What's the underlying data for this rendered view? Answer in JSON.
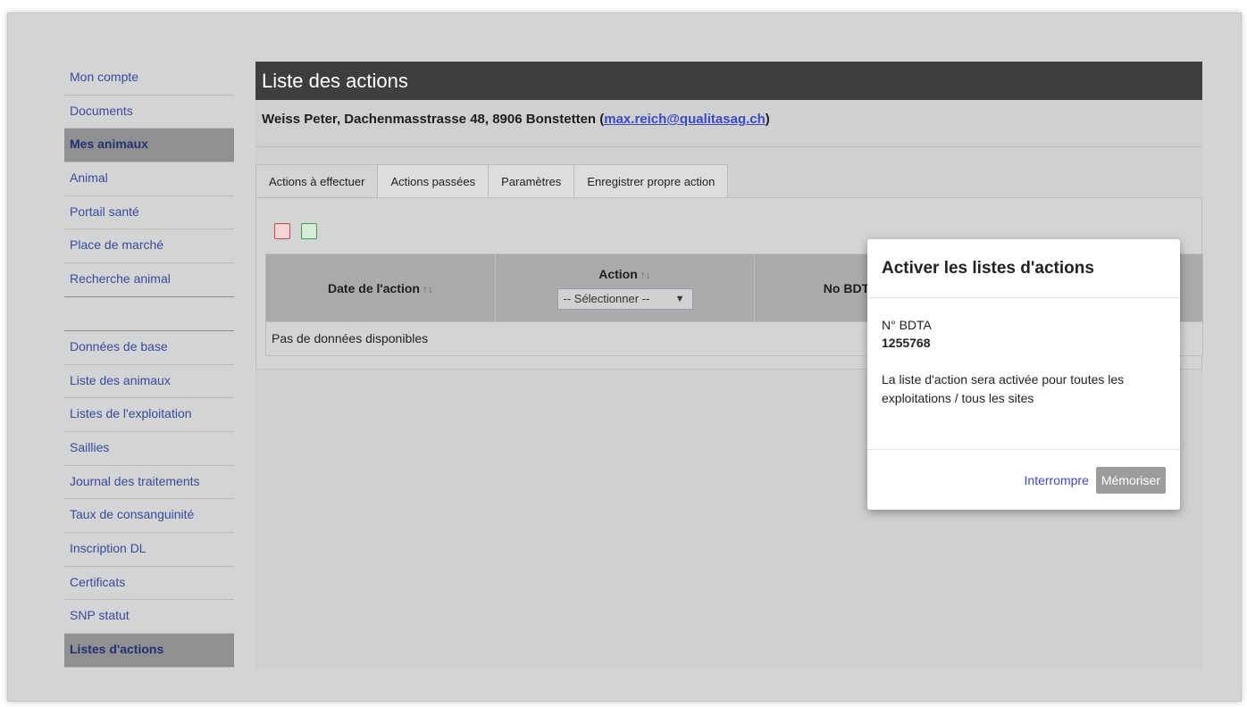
{
  "sidebar": {
    "items": [
      {
        "label": "Mon compte",
        "active": false
      },
      {
        "label": "Documents",
        "active": false
      },
      {
        "label": "Mes animaux",
        "active": true
      },
      {
        "label": "Animal",
        "active": false
      },
      {
        "label": "Portail santé",
        "active": false
      },
      {
        "label": "Place de marché",
        "active": false
      },
      {
        "label": "Recherche animal",
        "active": false
      }
    ],
    "items2": [
      {
        "label": "Données de base",
        "active": false
      },
      {
        "label": "Liste des animaux",
        "active": false
      },
      {
        "label": "Listes de l'exploitation",
        "active": false
      },
      {
        "label": "Saillies",
        "active": false
      },
      {
        "label": "Journal des traitements",
        "active": false
      },
      {
        "label": "Taux de consanguinité",
        "active": false
      },
      {
        "label": "Inscription DL",
        "active": false
      },
      {
        "label": "Certificats",
        "active": false
      },
      {
        "label": "SNP statut",
        "active": false
      },
      {
        "label": "Listes d'actions",
        "active": true
      }
    ]
  },
  "main": {
    "title": "Liste des actions",
    "owner": {
      "text": "Weiss Peter, Dachenmasstrasse 48, 8906 Bonstetten (",
      "email": "max.reich@qualitasag.ch",
      "close": ")"
    },
    "tabs": [
      {
        "label": "Actions à effectuer",
        "active": true
      },
      {
        "label": "Actions passées",
        "active": false
      },
      {
        "label": "Paramètres",
        "active": false
      },
      {
        "label": "Enregistrer propre action",
        "active": false
      }
    ],
    "toolbar": {
      "pdf_icon": "pdf-icon",
      "excel_icon": "excel-icon"
    },
    "table": {
      "columns": [
        "Date de l'action",
        "Action",
        "No BDTA"
      ],
      "sort_glyph": "↑↓",
      "action_select": "-- Sélectionner --",
      "empty": "Pas de données disponibles"
    }
  },
  "modal": {
    "title": "Activer les listes d'actions",
    "field_label": "N° BDTA",
    "field_value": "1255768",
    "text": "La liste d'action sera activée pour toutes les exploitations / tous les sites",
    "cancel": "Interrompre",
    "save": "Mémoriser"
  }
}
